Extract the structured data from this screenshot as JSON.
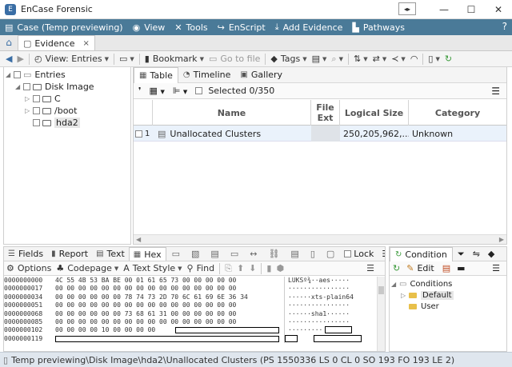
{
  "window": {
    "title": "EnCase Forensic",
    "minimize": "—",
    "maximize": "☐",
    "close": "✕"
  },
  "menubar": {
    "items": [
      {
        "label": "Case (Temp previewing)",
        "icon": "case-icon"
      },
      {
        "label": "View",
        "icon": "eye-icon"
      },
      {
        "label": "Tools",
        "icon": "wrench-icon"
      },
      {
        "label": "EnScript",
        "icon": "script-icon"
      },
      {
        "label": "Add Evidence",
        "icon": "add-evidence-icon"
      },
      {
        "label": "Pathways",
        "icon": "pathways-icon"
      }
    ],
    "help": "?"
  },
  "tabs": {
    "evidence_label": "Evidence",
    "close": "×"
  },
  "toolbar": {
    "view_label": "View: Entries",
    "bookmark_label": "Bookmark",
    "goto_label": "Go to file",
    "tags_label": "Tags"
  },
  "tree": {
    "root": "Entries",
    "disk": "Disk Image",
    "children": [
      "C",
      "/boot",
      "hda2"
    ]
  },
  "right_pane": {
    "tabs": [
      "Table",
      "Timeline",
      "Gallery"
    ],
    "selected": "Selected 0/350",
    "columns": [
      "Name",
      "File Ext",
      "Logical Size",
      "Category"
    ],
    "rows": [
      {
        "num": "1",
        "name": "Unallocated Clusters",
        "ext": "",
        "size": "250,205,962,...",
        "category": "Unknown"
      }
    ]
  },
  "bottom": {
    "tabs": [
      "Fields",
      "Report",
      "Text",
      "Hex"
    ],
    "toolbar": {
      "options": "Options",
      "codepage": "Codepage",
      "textstyle": "Text Style",
      "find": "Find",
      "lock": "Lock"
    },
    "hex_lines": [
      {
        "offset": "0000000000",
        "bytes": "4C 55 4B 53 BA BE 00 01 61 65 73 00 00 00 00 00",
        "ascii": "LUKSº¾··aes·····"
      },
      {
        "offset": "0000000017",
        "bytes": "00 00 00 00 00 00 00 00 00 00 00 00 00 00 00 00",
        "ascii": "················"
      },
      {
        "offset": "0000000034",
        "bytes": "00 00 00 00 00 00 78 74 73 2D 70 6C 61 69 6E 36 34",
        "ascii": "······xts-plain64"
      },
      {
        "offset": "0000000051",
        "bytes": "00 00 00 00 00 00 00 00 00 00 00 00 00 00 00 00",
        "ascii": "················"
      },
      {
        "offset": "0000000068",
        "bytes": "00 00 00 00 00 00 73 68 61 31 00 00 00 00 00 00",
        "ascii": "······sha1······"
      },
      {
        "offset": "0000000085",
        "bytes": "00 00 00 00 00 00 00 00 00 00 00 00 00 00 00 00",
        "ascii": "················"
      },
      {
        "offset": "0000000102",
        "bytes": "00 00 00 00 10 00 00 00 00",
        "ascii": "·········"
      },
      {
        "offset": "0000000119",
        "bytes": "",
        "ascii": ""
      }
    ]
  },
  "conditions": {
    "tab": "Condition",
    "edit": "Edit",
    "root": "Conditions",
    "items": [
      "Default",
      "User"
    ]
  },
  "status": "Temp previewing\\Disk Image\\hda2\\Unallocated Clusters (PS 1550336 LS 0 CL 0 SO 193 FO 193 LE 2)"
}
